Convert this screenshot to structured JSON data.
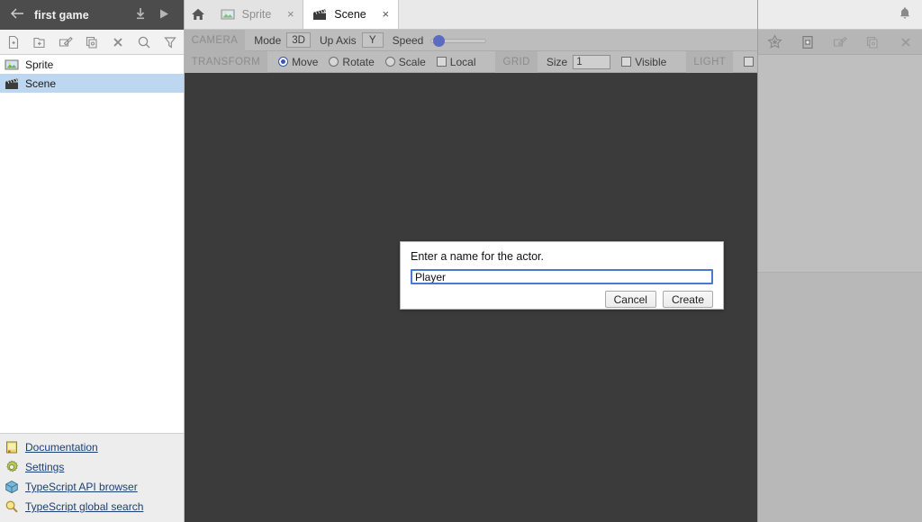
{
  "sidebar": {
    "header": {
      "back_label": "←",
      "project_title": "first game",
      "download_icon": "download-icon",
      "play_icon": "play-icon"
    },
    "toolbar": [
      {
        "name": "new-file-button",
        "icon": "new-file-icon"
      },
      {
        "name": "new-folder-button",
        "icon": "new-folder-icon"
      },
      {
        "name": "rename-button",
        "icon": "rename-icon"
      },
      {
        "name": "duplicate-button",
        "icon": "duplicate-icon"
      },
      {
        "name": "delete-button",
        "icon": "close-x-icon"
      },
      {
        "name": "search-button",
        "icon": "search-icon"
      },
      {
        "name": "filter-button",
        "icon": "filter-icon"
      }
    ],
    "tree": [
      {
        "label": "Sprite",
        "icon": "image-asset-icon",
        "selected": false
      },
      {
        "label": "Scene",
        "icon": "clapperboard-icon",
        "selected": true
      }
    ],
    "links": [
      {
        "label": "Documentation",
        "icon": "book-icon"
      },
      {
        "label": "Settings",
        "icon": "gear-icon"
      },
      {
        "label": "TypeScript API browser",
        "icon": "cube-icon"
      },
      {
        "label": "TypeScript global search",
        "icon": "search-icon"
      }
    ]
  },
  "tabbar": {
    "home_icon": "home-icon",
    "tabs": [
      {
        "label": "Sprite",
        "icon": "image-asset-icon",
        "active": false,
        "close": "×"
      },
      {
        "label": "Scene",
        "icon": "clapperboard-icon",
        "active": true,
        "close": "×"
      }
    ]
  },
  "camera_toolbar": {
    "section_label": "CAMERA",
    "mode_label": "Mode",
    "mode_value": "3D",
    "up_axis_label": "Up Axis",
    "up_axis_value": "Y",
    "speed_label": "Speed",
    "speed_percent": 8
  },
  "transform_toolbar": {
    "section_label": "TRANSFORM",
    "modes": [
      {
        "label": "Move",
        "checked": true
      },
      {
        "label": "Rotate",
        "checked": false
      },
      {
        "label": "Scale",
        "checked": false
      }
    ],
    "local_label": "Local",
    "local_checked": false,
    "grid_label": "GRID",
    "grid_size_label": "Size",
    "grid_size_value": "1",
    "grid_visible_label": "Visible",
    "grid_visible_checked": false,
    "light_label": "LIGHT",
    "light_checked": false
  },
  "right_panel": {
    "notification_icon": "bell-icon",
    "toolbar": [
      {
        "name": "favorite-button",
        "icon": "star-icon"
      },
      {
        "name": "add-component-button",
        "icon": "add-box-icon"
      },
      {
        "name": "rename-component-button",
        "icon": "rename-icon"
      },
      {
        "name": "duplicate-component-button",
        "icon": "duplicate-icon"
      },
      {
        "name": "delete-component-button",
        "icon": "close-x-icon"
      }
    ]
  },
  "modal": {
    "message": "Enter a name for the actor.",
    "input_value": "Player",
    "input_placeholder": "",
    "cancel_label": "Cancel",
    "create_label": "Create"
  },
  "colors": {
    "sidebar_header_bg": "#4c4c4c",
    "selection_blue": "#bdd7f1",
    "accent_blue": "#5c6bc0",
    "viewport_bg": "#3b3b3b",
    "link_blue": "#1b3f73",
    "focus_ring": "#4a78d1"
  }
}
